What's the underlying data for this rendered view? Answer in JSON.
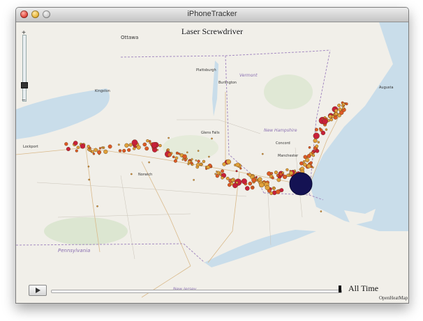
{
  "window": {
    "title": "iPhoneTracker"
  },
  "map": {
    "title": "Laser Screwdriver",
    "credit": "OpenHeatMap",
    "time_label": "All Time",
    "zoom_plus": "+",
    "zoom_minus": "−",
    "place_labels": {
      "ottawa": "Ottawa",
      "vermont": "Vermont",
      "new_hampshire": "New Hampshire",
      "plattsburgh": "Plattsburgh",
      "burlington": "Burlington",
      "concord": "Concord",
      "augusta": "Augusta",
      "kingston": "Kingston",
      "norwich": "Norwich",
      "glens_falls": "Glens Falls",
      "pennsylvania": "Pennsylvania",
      "new_jersey": "New Jersey",
      "lockport": "Lockport",
      "manchester": "Manchester"
    }
  },
  "colors": {
    "water": "#c9ddea",
    "land": "#f1efe9",
    "heat_low": "#e0a13a",
    "heat_mid": "#dd5a25",
    "heat_high": "#c7203a",
    "hotspot": "#141253"
  }
}
